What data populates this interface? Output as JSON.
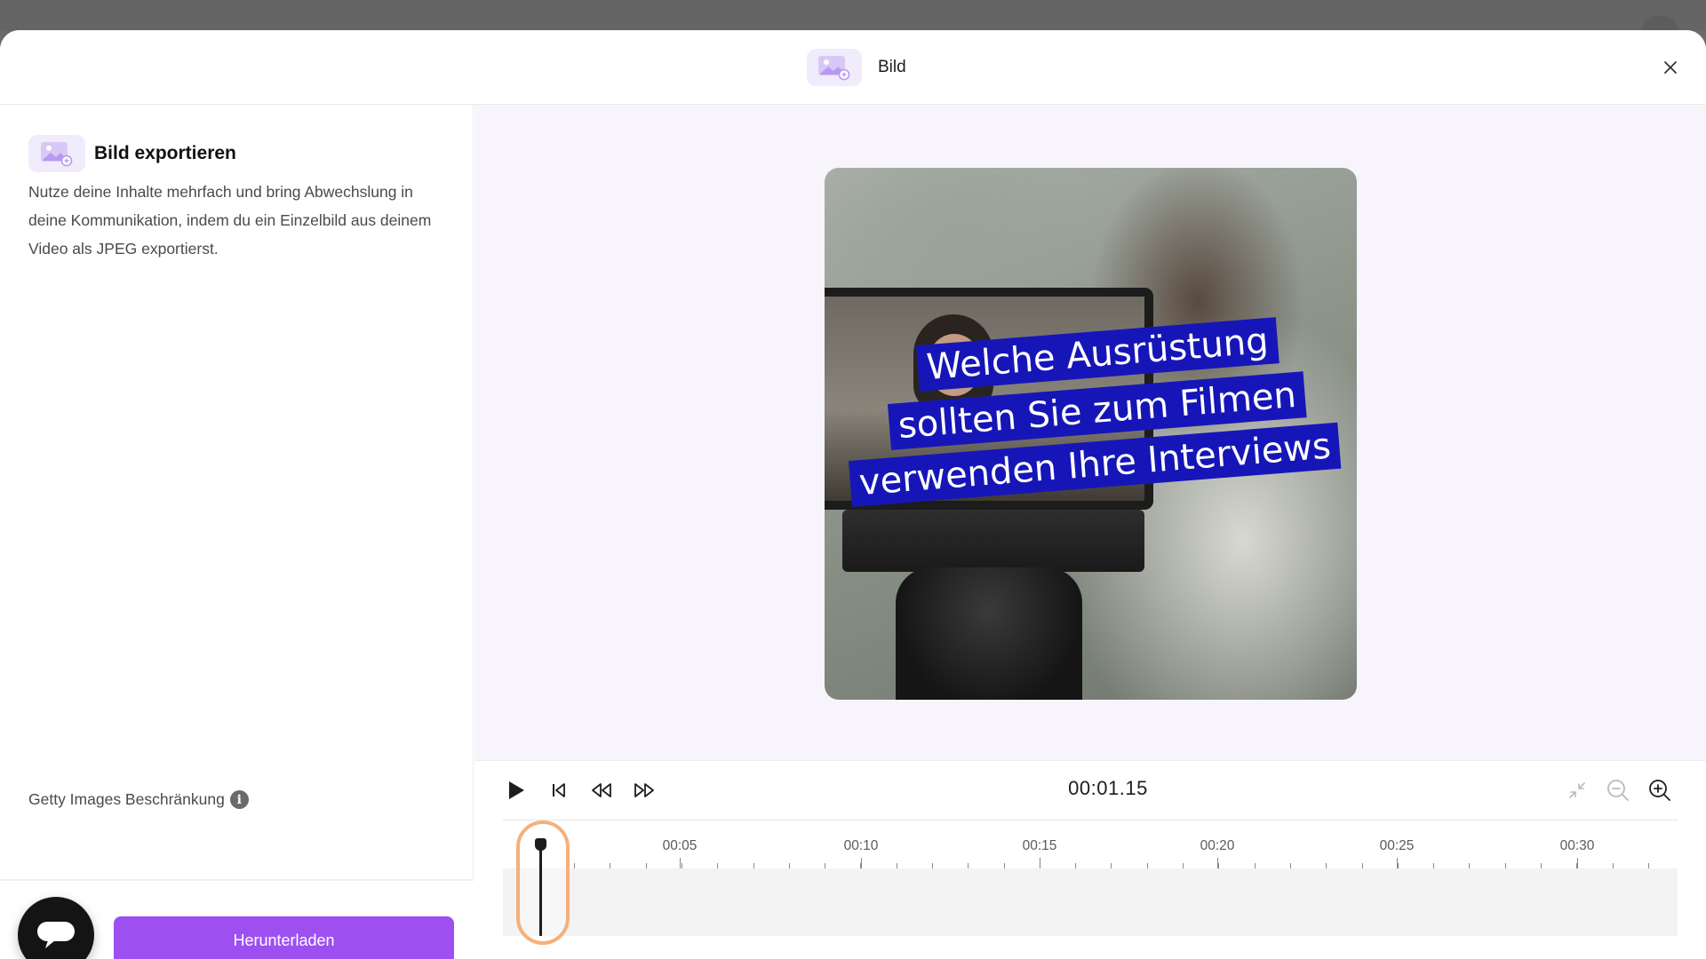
{
  "header": {
    "title": "Bild",
    "badge_icon": "image-icon",
    "close_icon": "close-icon"
  },
  "export": {
    "title": "Bild exportieren",
    "description": "Nutze deine Inhalte mehrfach und bring Abwechslung in deine Kommunikation, indem du ein Einzelbild aus deinem Video als JPEG exportierst.",
    "getty_label": "Getty Images Beschränkung",
    "info_glyph": "i",
    "download_label": "Herunterladen"
  },
  "video": {
    "caption_lines": [
      "Welche Ausrüstung",
      "sollten Sie zum Filmen",
      "verwenden Ihre Interviews"
    ],
    "caption_color": "#1616b8"
  },
  "controls": {
    "timecode": "00:01.15",
    "buttons": [
      "play-icon",
      "skip-to-start-icon",
      "rewind-icon",
      "fast-forward-icon"
    ],
    "right_buttons": [
      "collapse-icon",
      "zoom-out-icon",
      "zoom-in-icon"
    ]
  },
  "timeline": {
    "labels": [
      "00:05",
      "00:10",
      "00:15",
      "00:20",
      "00:25",
      "00:30"
    ]
  },
  "colors": {
    "accent": "#9d4ff0",
    "badge_bg": "#f1ecfb",
    "playhead_ring": "#f5b07a",
    "preview_bg": "#f7f4fc"
  }
}
